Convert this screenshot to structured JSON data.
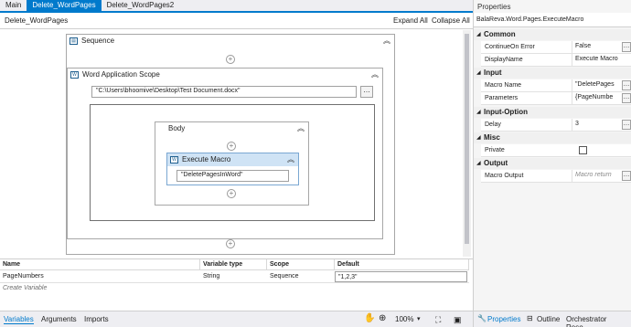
{
  "tabs": [
    {
      "label": "Main"
    },
    {
      "label": "Delete_WordPages"
    },
    {
      "label": "Delete_WordPages2"
    }
  ],
  "designer": {
    "title": "Delete_WordPages",
    "expand_all": "Expand All",
    "collapse_all": "Collapse All"
  },
  "workflow": {
    "sequence_label": "Sequence",
    "scope_label": "Word Application Scope",
    "scope_path": "\"C:\\Users\\bhoomive\\Desktop\\Test Document.docx\"",
    "body_label": "Body",
    "macro_label": "Execute Macro",
    "macro_value": "\"DeletePagesInWord\""
  },
  "variables": {
    "headers": [
      "Name",
      "Variable type",
      "Scope",
      "Default"
    ],
    "row": {
      "name": "PageNumbers",
      "type": "String",
      "scope": "Sequence",
      "default": "\"1,2,3\""
    },
    "create": "Create Variable"
  },
  "bottom": {
    "tabs": [
      "Variables",
      "Arguments",
      "Imports"
    ],
    "zoom": "100%"
  },
  "properties": {
    "title": "Properties",
    "type": "BalaReva.Word.Pages.ExecuteMacro",
    "categories": {
      "common": "Common",
      "input": "Input",
      "input_option": "Input-Option",
      "misc": "Misc",
      "output": "Output"
    },
    "rows": {
      "continue_on_error": {
        "name": "ContinueOn Error",
        "value": "False"
      },
      "display_name": {
        "name": "DisplayName",
        "value": "Execute Macro"
      },
      "macro_name": {
        "name": "Macro Name",
        "value": "\"DeletePages"
      },
      "parameters": {
        "name": "Parameters",
        "value": "{PageNumbe"
      },
      "delay": {
        "name": "Delay",
        "value": "3"
      },
      "private": {
        "name": "Private"
      },
      "macro_output": {
        "name": "Macro Output",
        "placeholder": "Macro return"
      }
    },
    "bottom_tabs": [
      "Properties",
      "Outline",
      "Orchestrator Reso..."
    ]
  },
  "colors": {
    "accent": "#007acc",
    "selected_activity": "#cfe3f5"
  }
}
